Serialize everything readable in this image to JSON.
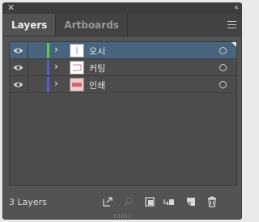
{
  "panel": {
    "tabs": [
      {
        "label": "Layers",
        "active": true
      },
      {
        "label": "Artboards",
        "active": false
      }
    ]
  },
  "layers": [
    {
      "name": "오시",
      "color": "#4fd44f",
      "selected": true,
      "visible": true
    },
    {
      "name": "커팅",
      "color": "#5a5ad6",
      "selected": false,
      "visible": true
    },
    {
      "name": "인쇄",
      "color": "#5a5ad6",
      "selected": false,
      "visible": true
    }
  ],
  "footer": {
    "layer_count": "3 Layers"
  },
  "icons": {
    "close": "close-icon",
    "collapse": "double-chevron-icon",
    "menu": "hamburger-menu-icon",
    "eye": "eye-icon",
    "export": "export-icon",
    "locate": "search-icon",
    "clipping_mask": "clipping-mask-icon",
    "sublayer": "new-sublayer-icon",
    "new_layer": "new-layer-icon",
    "delete": "trash-icon"
  },
  "colors": {
    "panel_bg": "#535353",
    "selection": "#48647e"
  }
}
